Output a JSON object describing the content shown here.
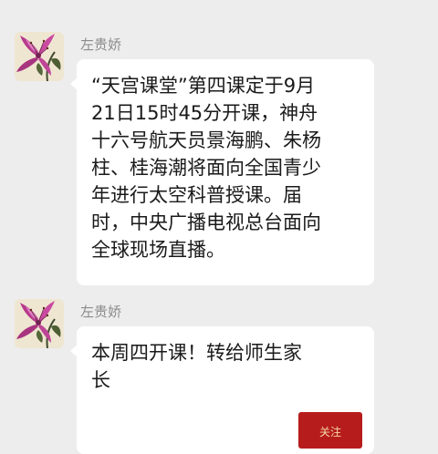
{
  "messages": [
    {
      "sender": "左贵娇",
      "lines": [
        "“天宫课堂”第四课定于9月",
        "21日15时45分开课，神舟",
        "十六号航天员景海鹏、朱杨",
        "柱、桂海潮将面向全国青少",
        "年进行太空科普授课。届",
        "时，中央广播电视总台面向",
        "全球现场直播。"
      ]
    },
    {
      "sender": "左贵娇",
      "lines": [
        "本周四开课！转给师生家",
        "长"
      ]
    }
  ],
  "follow_button": {
    "label": "关注"
  },
  "colors": {
    "background": "#ededed",
    "bubble": "#ffffff",
    "sender_text": "#8c8c8c",
    "follow_button": "#b71c1c"
  },
  "icons": {
    "avatar": "lily-flower-avatar"
  }
}
